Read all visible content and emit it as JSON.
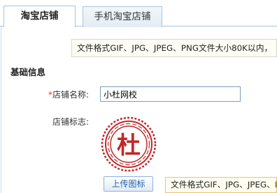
{
  "tabs": [
    {
      "label": "淘宝店铺",
      "active": true
    },
    {
      "label": "手机淘宝店铺",
      "active": false
    }
  ],
  "hints": {
    "format_top": "文件格式GIF、JPG、JPEG、PNG文件大小80K以内，",
    "format_bottom": "文件格式GIF、JPG、JPEG、PNG"
  },
  "section": {
    "title": "基础信息"
  },
  "form": {
    "required_mark": "*",
    "shop_name_label": "店铺名称:",
    "shop_name_value": "小杜网校",
    "logo_label": "店铺标志:",
    "logo_text": "杜",
    "upload_button": "上传图标"
  },
  "colors": {
    "tab_border": "#a9c4de",
    "seal_red": "#c0282a",
    "required_red": "#e4393c",
    "button_text": "#1f5fa8"
  },
  "icons": {
    "logo": "red-seal-stamp"
  }
}
